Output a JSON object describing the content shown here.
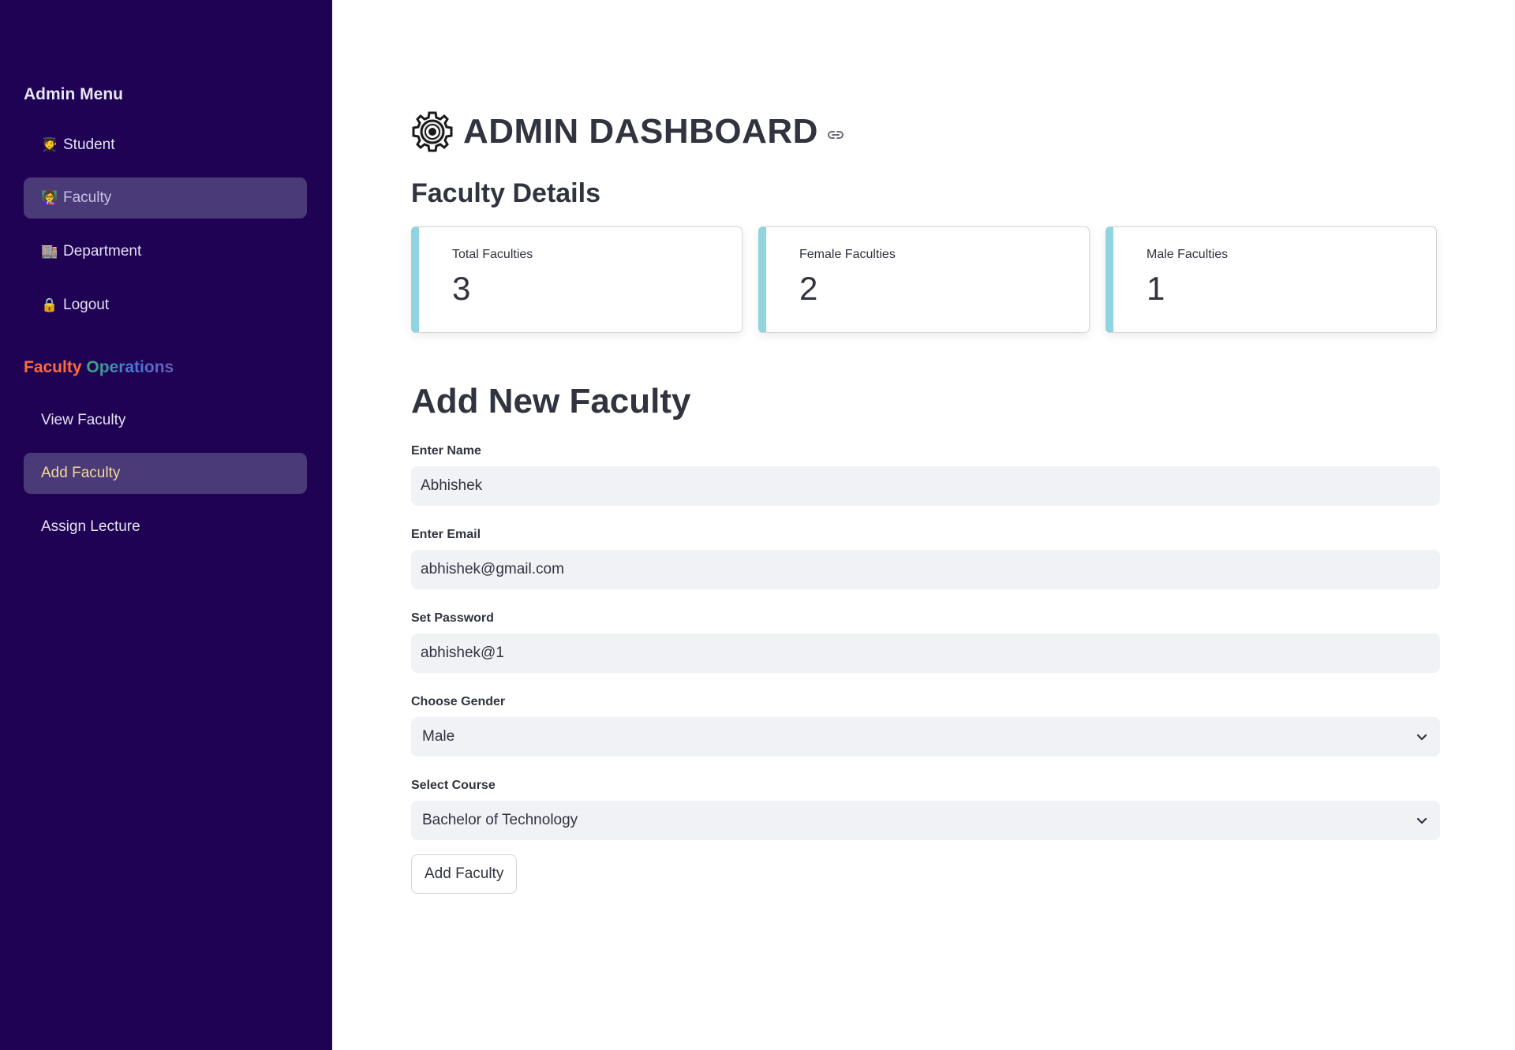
{
  "sidebar": {
    "admin_menu_title": "Admin Menu",
    "menu_items": [
      {
        "label": "Student",
        "icon": "🧑‍🎓"
      },
      {
        "label": "Faculty",
        "icon": "👩‍🏫"
      },
      {
        "label": "Department",
        "icon": "🏬"
      },
      {
        "label": "Logout",
        "icon": "🔒"
      }
    ],
    "operations_title_part1": "Faculty",
    "operations_title_part2": " Operations",
    "operations": [
      {
        "label": "View Faculty"
      },
      {
        "label": "Add Faculty"
      },
      {
        "label": "Assign Lecture"
      }
    ]
  },
  "header": {
    "title": "ADMIN DASHBOARD",
    "icon": "gear-icon"
  },
  "faculty_details": {
    "title": "Faculty Details",
    "metrics": [
      {
        "label": "Total Faculties",
        "value": "3"
      },
      {
        "label": "Female Faculties",
        "value": "2"
      },
      {
        "label": "Male Faculties",
        "value": "1"
      }
    ]
  },
  "form": {
    "title": "Add New Faculty",
    "name_label": "Enter Name",
    "name_value": "Abhishek",
    "email_label": "Enter Email",
    "email_value": "abhishek@gmail.com",
    "password_label": "Set Password",
    "password_value": "abhishek@1",
    "gender_label": "Choose Gender",
    "gender_value": "Male",
    "course_label": "Select Course",
    "course_value": "Bachelor of Technology",
    "submit_label": "Add Faculty"
  },
  "colors": {
    "sidebar_bg": "#1f0254",
    "active_item_bg": "#4b3a78",
    "metric_accent": "#8fd4de",
    "input_bg": "#f0f2f6"
  }
}
